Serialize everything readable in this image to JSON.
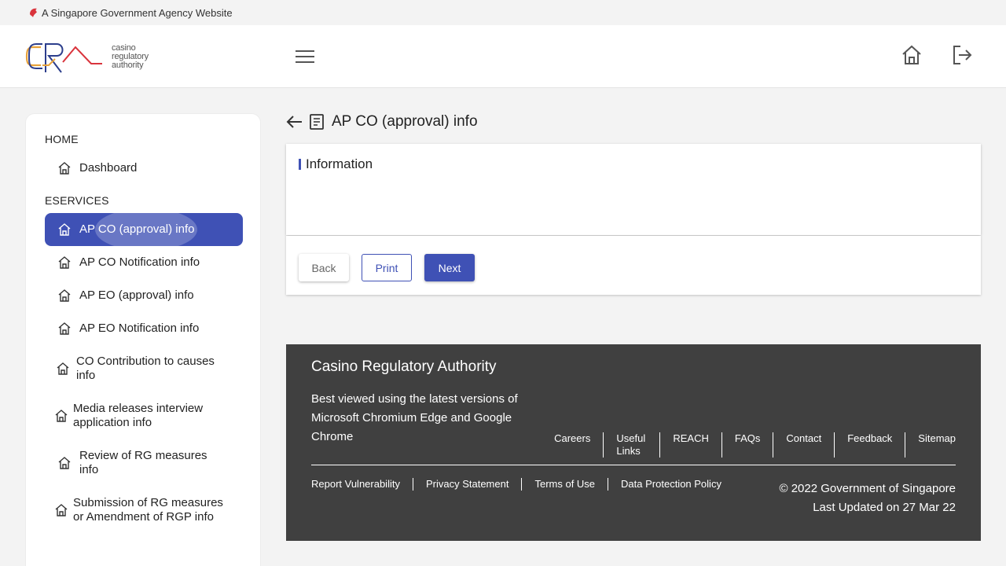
{
  "banner": {
    "text": "A Singapore Government Agency Website"
  },
  "header": {
    "logo_lines": [
      "casino",
      "regulatory",
      "authority"
    ],
    "menu_icon": "hamburger-menu-icon",
    "home_icon": "home-icon",
    "logout_icon": "logout-icon"
  },
  "sidebar": {
    "sections": [
      {
        "title": "HOME",
        "items": [
          {
            "label": "Dashboard"
          }
        ]
      },
      {
        "title": "ESERVICES",
        "items": [
          {
            "label": "AP CO (approval) info",
            "active": true
          },
          {
            "label": "AP CO Notification info"
          },
          {
            "label": "AP EO (approval) info"
          },
          {
            "label": "AP EO Notification info"
          },
          {
            "label": "CO Contribution to causes info"
          },
          {
            "label": "Media releases interview application info"
          },
          {
            "label": "Review of RG measures info"
          },
          {
            "label": "Submission of RG measures or Amendment of RGP info"
          }
        ]
      }
    ]
  },
  "main": {
    "title": "AP CO (approval) info",
    "card_title": "Information",
    "buttons": {
      "back": "Back",
      "print": "Print",
      "next": "Next"
    }
  },
  "footer": {
    "title": "Casino Regulatory Authority",
    "description": "Best viewed using the latest versions of Microsoft Chromium Edge and Google Chrome",
    "links": [
      "Careers",
      "Useful Links",
      "REACH",
      "FAQs",
      "Contact",
      "Feedback",
      "Sitemap"
    ],
    "bottom_links": [
      "Report Vulnerability",
      "Privacy Statement",
      "Terms of Use",
      "Data Protection Policy"
    ],
    "copyright": "© 2022 Government of Singapore",
    "updated": "Last Updated on 27 Mar 22"
  },
  "colors": {
    "accent": "#3f51b5",
    "footer_bg": "#404040",
    "logo_orange": "#e8a23a",
    "logo_blue": "#2c3e8c",
    "logo_red": "#d9343c"
  }
}
